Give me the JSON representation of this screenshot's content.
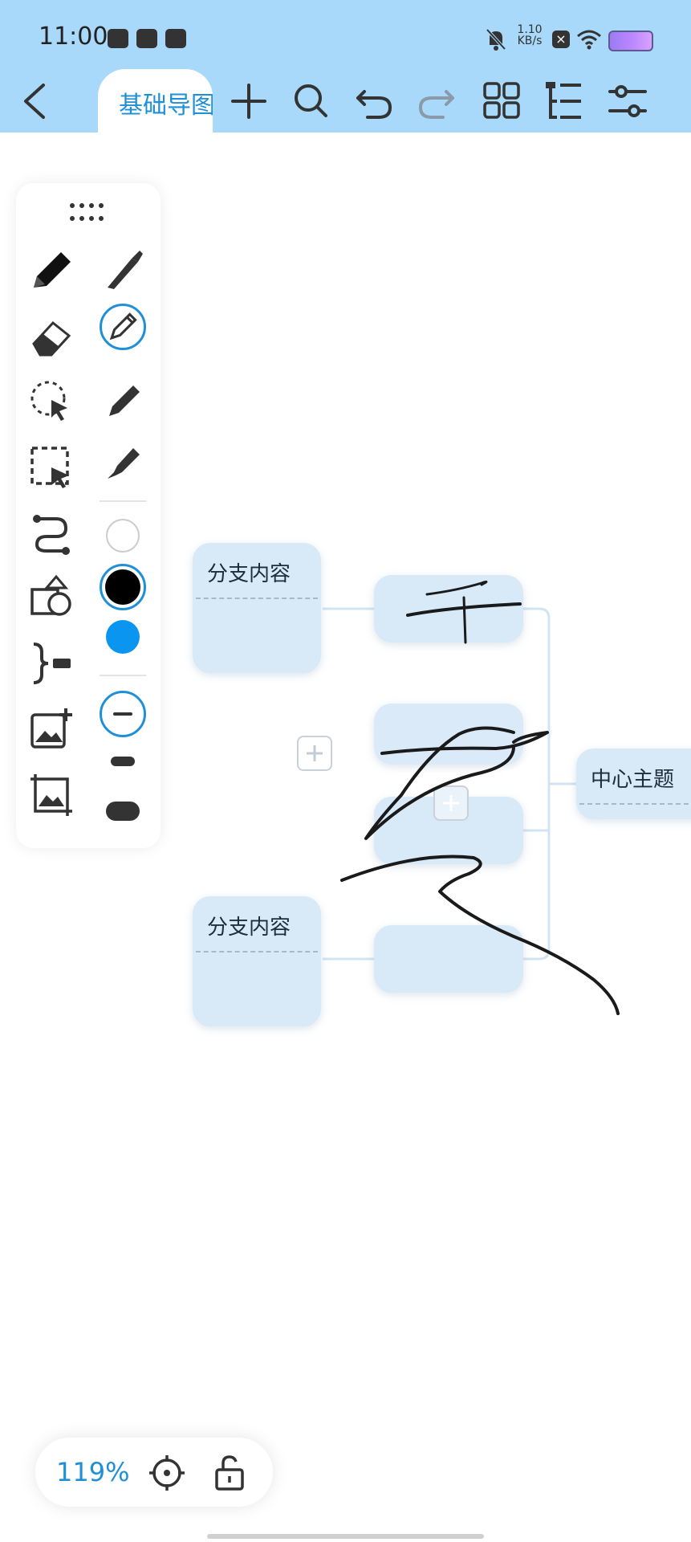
{
  "status_bar": {
    "time": "11:00",
    "net_speed_value": "1.10",
    "net_speed_unit": "KB/s"
  },
  "toolbar": {
    "tab_label": "基础导图",
    "icons": [
      "back-icon",
      "add-icon",
      "search-icon",
      "undo-icon",
      "redo-icon",
      "grid-icon",
      "outline-icon",
      "settings-icon"
    ]
  },
  "mindmap": {
    "center_topic": "中心主题",
    "branch_top": "分支内容",
    "branch_bottom": "分支内容"
  },
  "palette": {
    "tools": [
      "pencil-icon",
      "eraser-icon",
      "lasso-icon",
      "selection-icon",
      "connector-icon",
      "shape-icon",
      "bracket-icon",
      "add-image-icon",
      "crop-image-icon"
    ],
    "colors": {
      "white": "#ffffff",
      "black": "#000000",
      "blue": "#0a96f0"
    },
    "accent": "#1f8fd8"
  },
  "zoom": {
    "level": "119%"
  }
}
